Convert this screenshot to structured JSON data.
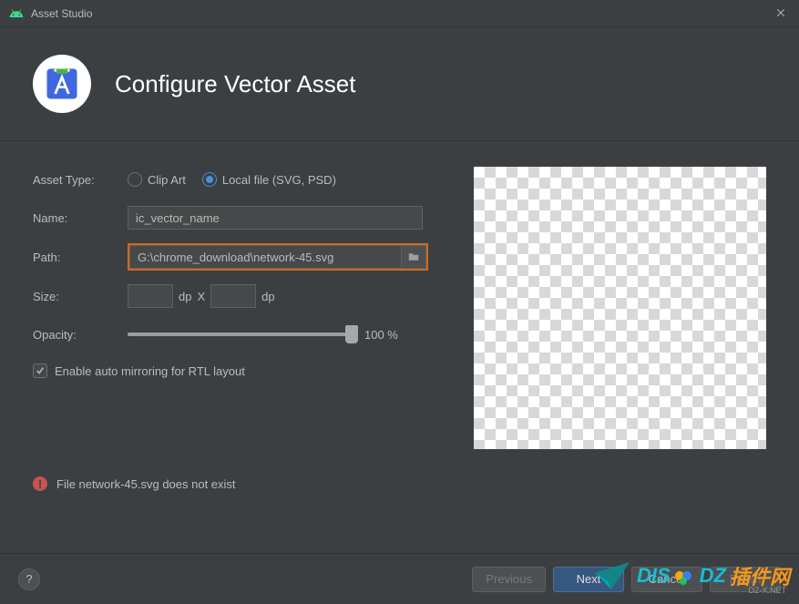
{
  "titlebar": {
    "app_title": "Asset Studio"
  },
  "header": {
    "title": "Configure Vector Asset"
  },
  "form": {
    "asset_type_label": "Asset Type:",
    "radio_clip_art": "Clip Art",
    "radio_local_file": "Local file (SVG, PSD)",
    "name_label": "Name:",
    "name_value": "ic_vector_name",
    "path_label": "Path:",
    "path_value": "G:\\chrome_download\\network-45.svg",
    "size_label": "Size:",
    "size_width": "",
    "size_height": "",
    "size_unit": "dp",
    "size_sep": "X",
    "opacity_label": "Opacity:",
    "opacity_value": "100 %",
    "opacity_percent": 100,
    "rtl_checked": true,
    "rtl_label": "Enable auto mirroring for RTL layout"
  },
  "error": {
    "message": "File network-45.svg does not exist"
  },
  "footer": {
    "help": "?",
    "previous": "Previous",
    "next": "Next",
    "cancel": "Cancel",
    "finish": "Finish"
  },
  "watermark": {
    "brand1": "DIS",
    "brand2": "DZ",
    "brand3": "插件网",
    "sub": "DZ-X.NET"
  }
}
